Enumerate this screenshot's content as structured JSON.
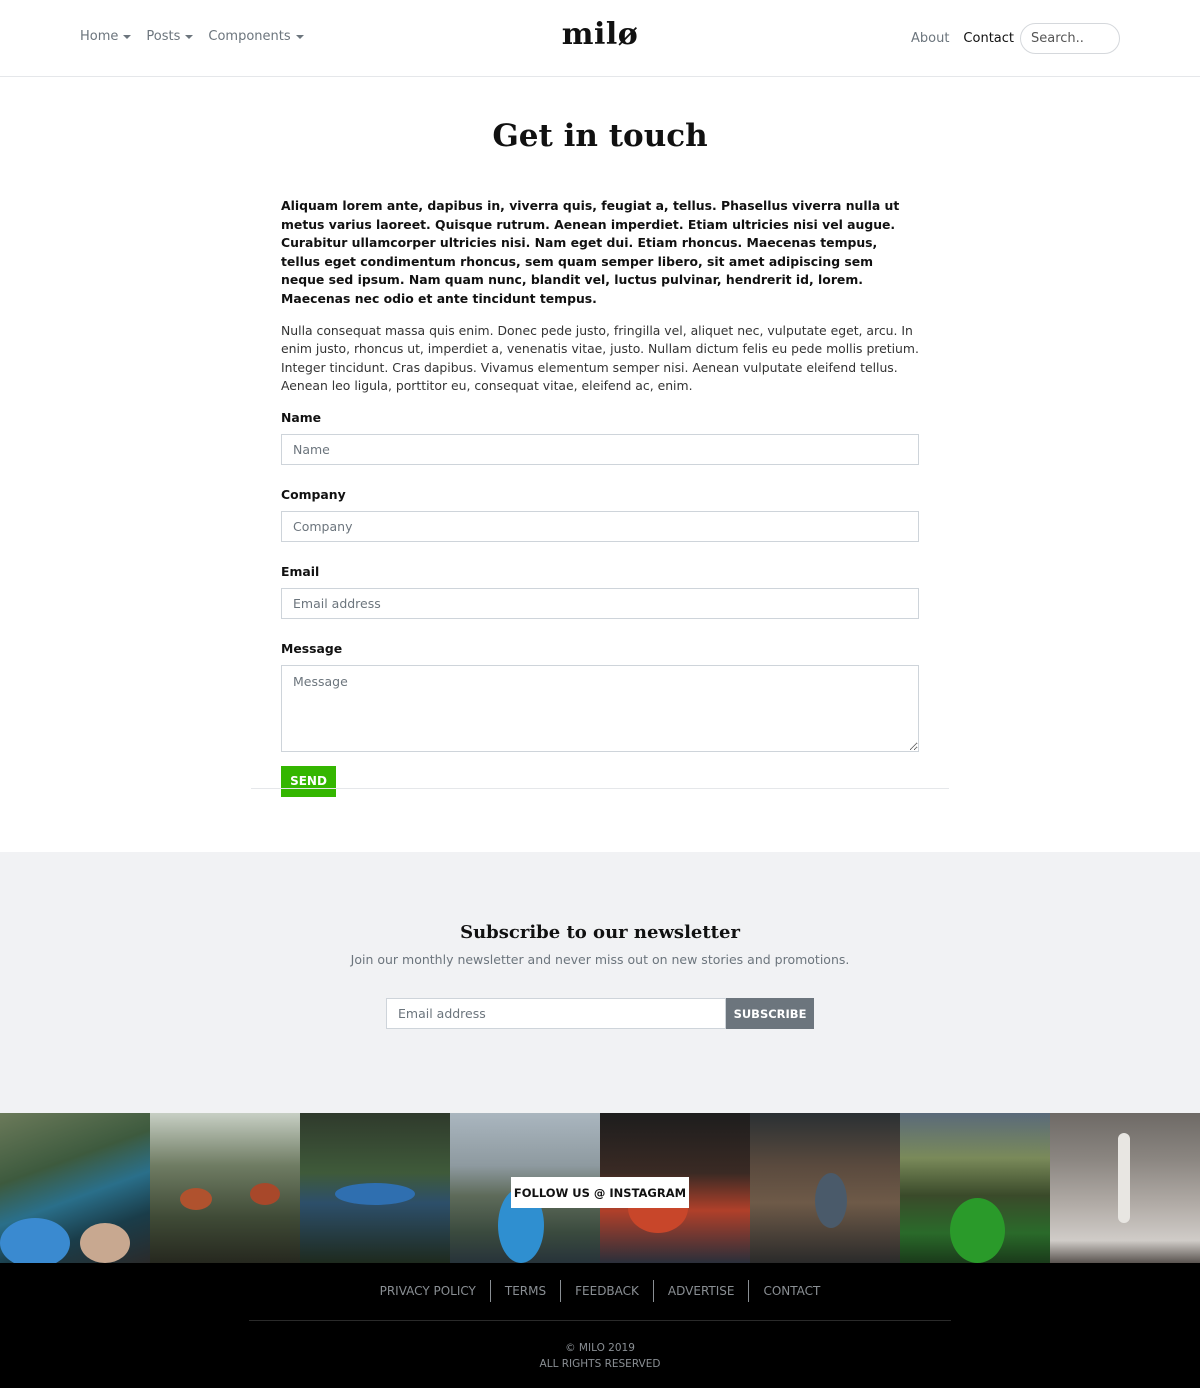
{
  "navbar": {
    "brand": "milø",
    "left_menu": [
      {
        "label": "Home"
      },
      {
        "label": "Posts"
      },
      {
        "label": "Components"
      }
    ],
    "about_label": "About",
    "contact_label": "Contact",
    "search_placeholder": "Search.."
  },
  "main": {
    "title": "Get in touch",
    "lead": "Aliquam lorem ante, dapibus in, viverra quis, feugiat a, tellus. Phasellus viverra nulla ut metus varius laoreet. Quisque rutrum. Aenean imperdiet. Etiam ultricies nisi vel augue. Curabitur ullamcorper ultricies nisi. Nam eget dui. Etiam rhoncus. Maecenas tempus, tellus eget condimentum rhoncus, sem quam semper libero, sit amet adipiscing sem neque sed ipsum. Nam quam nunc, blandit vel, luctus pulvinar, hendrerit id, lorem. Maecenas nec odio et ante tincidunt tempus.",
    "paragraph": "Nulla consequat massa quis enim. Donec pede justo, fringilla vel, aliquet nec, vulputate eget, arcu. In enim justo, rhoncus ut, imperdiet a, venenatis vitae, justo. Nullam dictum felis eu pede mollis pretium. Integer tincidunt. Cras dapibus. Vivamus elementum semper nisi. Aenean vulputate eleifend tellus. Aenean leo ligula, porttitor eu, consequat vitae, eleifend ac, enim.",
    "form": {
      "name_label": "Name",
      "name_placeholder": "Name",
      "company_label": "Company",
      "company_placeholder": "Company",
      "email_label": "Email",
      "email_placeholder": "Email address",
      "message_label": "Message",
      "message_placeholder": "Message",
      "send_label": "SEND",
      "send_color": "#34b600"
    }
  },
  "newsletter": {
    "title": "Subscribe to our newsletter",
    "subtitle": "Join our monthly newsletter and never miss out on new stories and promotions.",
    "email_placeholder": "Email address",
    "button_label": "SUBSCRIBE"
  },
  "instagram": {
    "label": "FOLLOW US @ INSTAGRAM"
  },
  "footer": {
    "links": [
      {
        "label": "PRIVACY POLICY"
      },
      {
        "label": "TERMS"
      },
      {
        "label": "FEEDBACK"
      },
      {
        "label": "ADVERTISE"
      },
      {
        "label": "CONTACT"
      }
    ],
    "copyright": "© MILO 2019",
    "rights": "ALL RIGHTS RESERVED"
  }
}
